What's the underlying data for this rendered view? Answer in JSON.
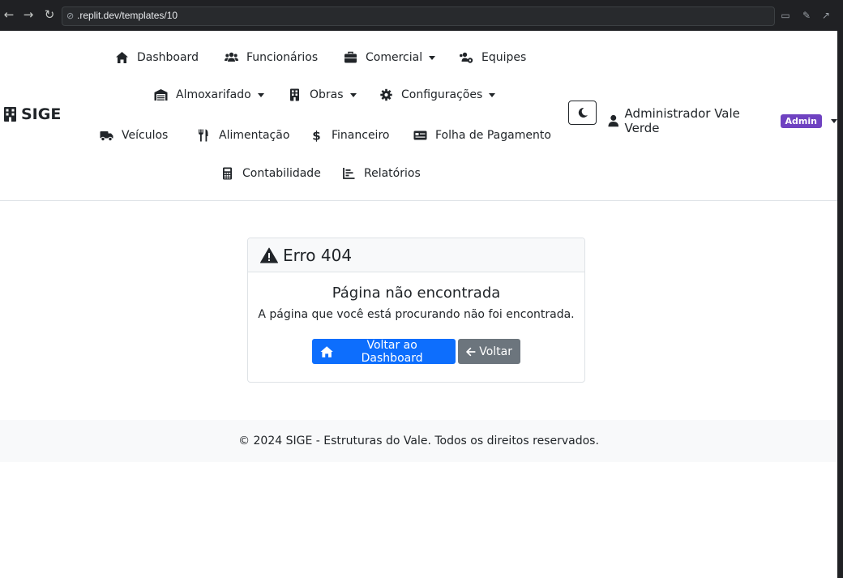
{
  "browser": {
    "url": ".replit.dev/templates/10",
    "icons": [
      "back-icon",
      "forward-icon",
      "reload-icon",
      "link-icon",
      "devices-icon",
      "wrench-icon",
      "open-external-icon"
    ]
  },
  "brand": {
    "name": "SIGE",
    "icon": "building-icon"
  },
  "nav": {
    "dashboard": "Dashboard",
    "funcionarios": "Funcionários",
    "comercial": "Comercial",
    "equipes": "Equipes",
    "almoxarifado": "Almoxarifado",
    "obras": "Obras",
    "configuracoes": "Configurações",
    "veiculos": "Veículos",
    "alimentacao": "Alimentação",
    "financeiro": "Financeiro",
    "folha": "Folha de Pagamento",
    "contabilidade": "Contabilidade",
    "relatorios": "Relatórios"
  },
  "user": {
    "name": "Administrador Vale Verde",
    "badge": "Admin",
    "badge_color": "#6f42c1"
  },
  "error": {
    "title": "Erro 404",
    "subtitle": "Página não encontrada",
    "message": "A página que você está procurando não foi encontrada.",
    "primary_button": "Voltar ao Dashboard",
    "secondary_button": "Voltar"
  },
  "footer": {
    "text": "© 2024 SIGE - Estruturas do Vale. Todos os direitos reservados."
  },
  "colors": {
    "primary": "#0d6efd",
    "secondary": "#6c757d",
    "dark": "#212529",
    "light": "#f8f9fa"
  }
}
